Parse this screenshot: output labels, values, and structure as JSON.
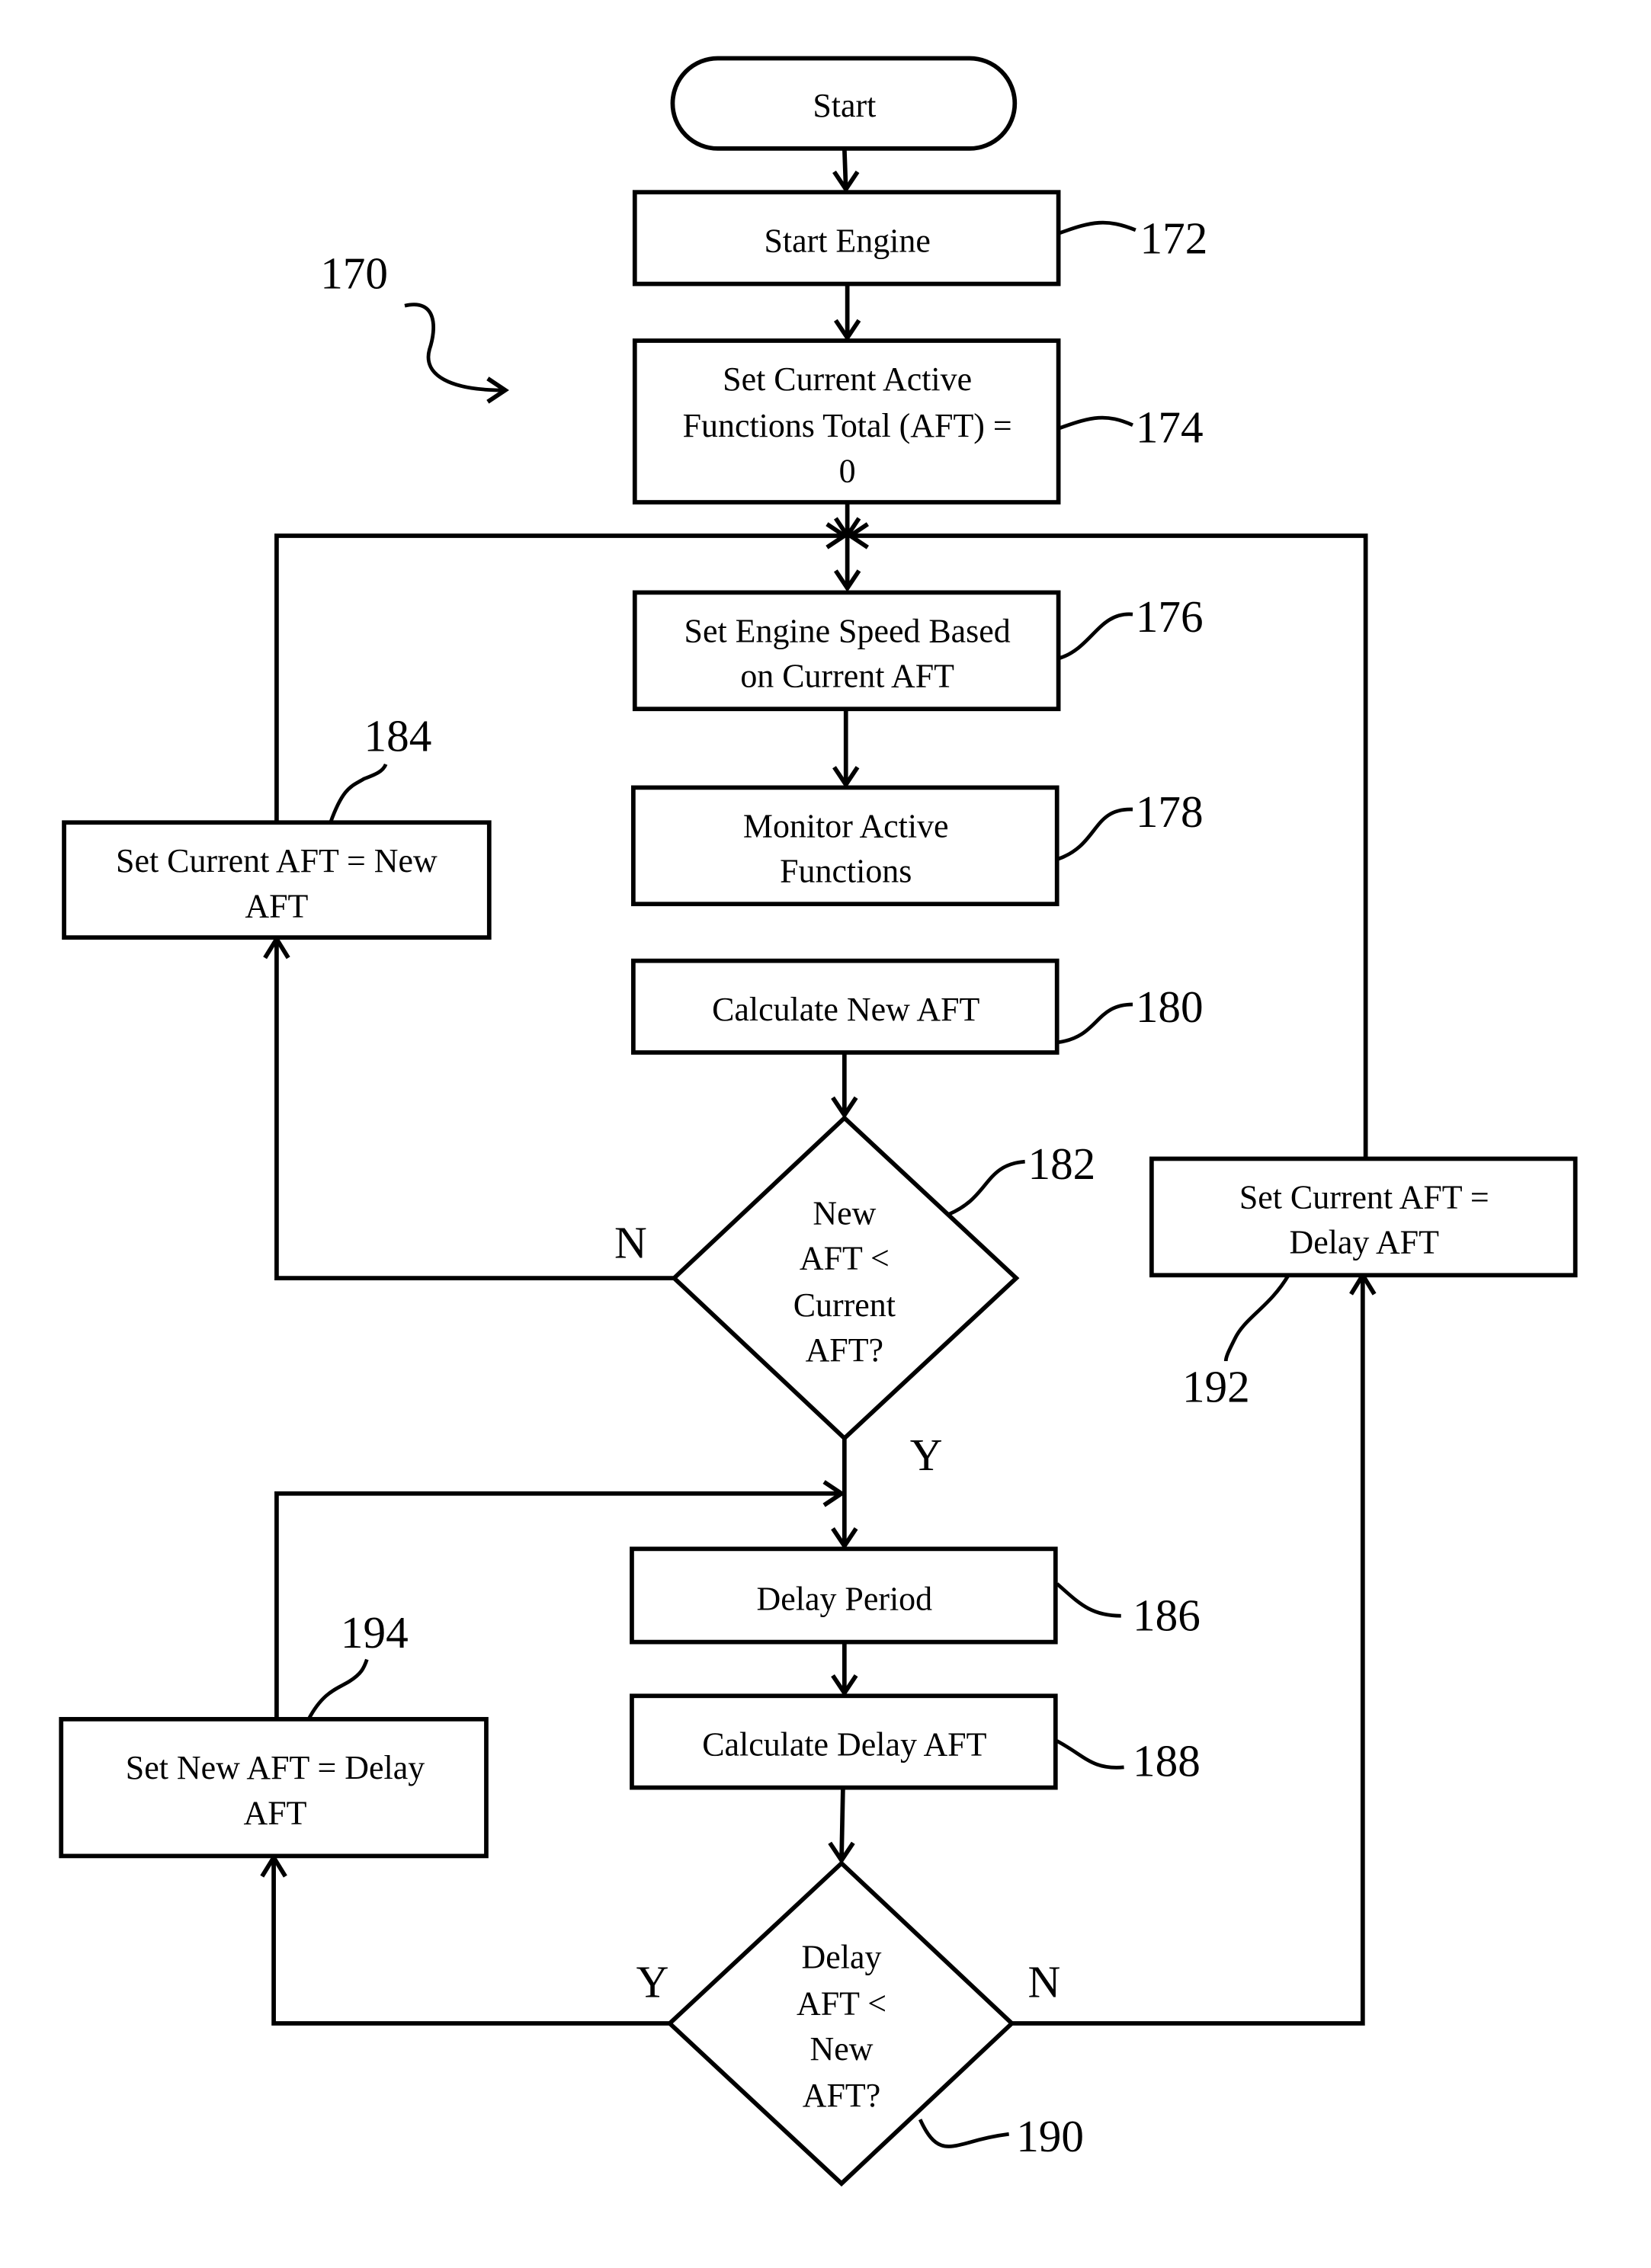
{
  "figure_label": "170",
  "nodes": {
    "start": {
      "lines": [
        "Start"
      ]
    },
    "n172": {
      "ref": "172",
      "lines": [
        "Start Engine"
      ]
    },
    "n174": {
      "ref": "174",
      "lines": [
        "Set Current Active",
        "Functions Total (AFT) =",
        "0"
      ]
    },
    "n176": {
      "ref": "176",
      "lines": [
        "Set Engine Speed Based",
        "on Current AFT"
      ]
    },
    "n178": {
      "ref": "178",
      "lines": [
        "Monitor Active",
        "Functions"
      ]
    },
    "n180": {
      "ref": "180",
      "lines": [
        "Calculate New AFT"
      ]
    },
    "n182": {
      "ref": "182",
      "lines": [
        "New",
        "AFT <",
        "Current",
        "AFT?"
      ]
    },
    "n184": {
      "ref": "184",
      "lines": [
        "Set Current AFT = New",
        "AFT"
      ]
    },
    "n186": {
      "ref": "186",
      "lines": [
        "Delay Period"
      ]
    },
    "n188": {
      "ref": "188",
      "lines": [
        "Calculate Delay AFT"
      ]
    },
    "n190": {
      "ref": "190",
      "lines": [
        "Delay",
        "AFT <",
        "New",
        "AFT?"
      ]
    },
    "n192": {
      "ref": "192",
      "lines": [
        "Set Current AFT =",
        "Delay AFT"
      ]
    },
    "n194": {
      "ref": "194",
      "lines": [
        "Set New AFT = Delay",
        "AFT"
      ]
    }
  },
  "branch_labels": {
    "d182_no": "N",
    "d182_yes": "Y",
    "d190_yes": "Y",
    "d190_no": "N"
  }
}
